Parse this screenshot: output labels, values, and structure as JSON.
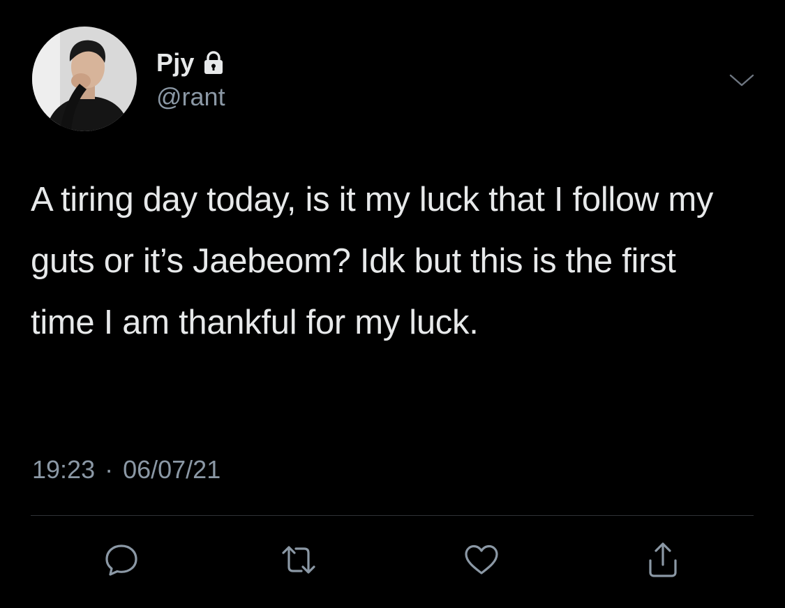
{
  "author": {
    "display_name": "Pjy",
    "handle": "@rant",
    "protected_icon": "lock-icon"
  },
  "tweet": {
    "text": "A tiring day today, is it my luck that I follow my guts or it’s Jaebeom? Idk but this is the first time I am thankful for my luck.",
    "time": "19:23",
    "separator": "·",
    "date": "06/07/21"
  },
  "actions": {
    "reply_icon": "comment-icon",
    "retweet_icon": "retweet-icon",
    "like_icon": "heart-icon",
    "share_icon": "share-icon"
  },
  "menu_icon": "chevron-down-icon",
  "colors": {
    "background": "#000000",
    "primary_text": "#e7e9ea",
    "secondary_text": "#8b98a5",
    "divider": "#2f3336"
  }
}
